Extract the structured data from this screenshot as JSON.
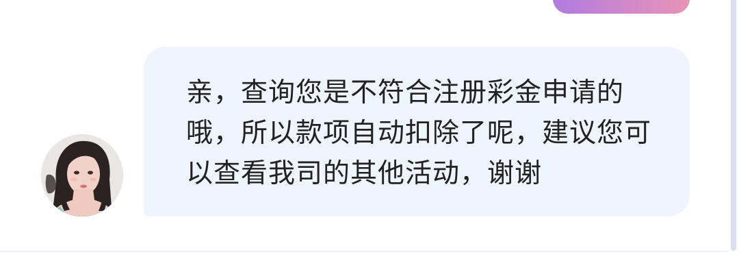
{
  "chat": {
    "received_message": {
      "text": "亲，查询您是不符合注册彩金申请的哦，所以款项自动扣除了呢，建议您可以查看我司的其他活动，谢谢",
      "bubble_color": "#eef5ff"
    },
    "sent_message": {
      "gradient_start": "#b07ae0",
      "gradient_end": "#e894b8"
    },
    "avatar": {
      "icon": "agent-avatar-photo"
    }
  }
}
